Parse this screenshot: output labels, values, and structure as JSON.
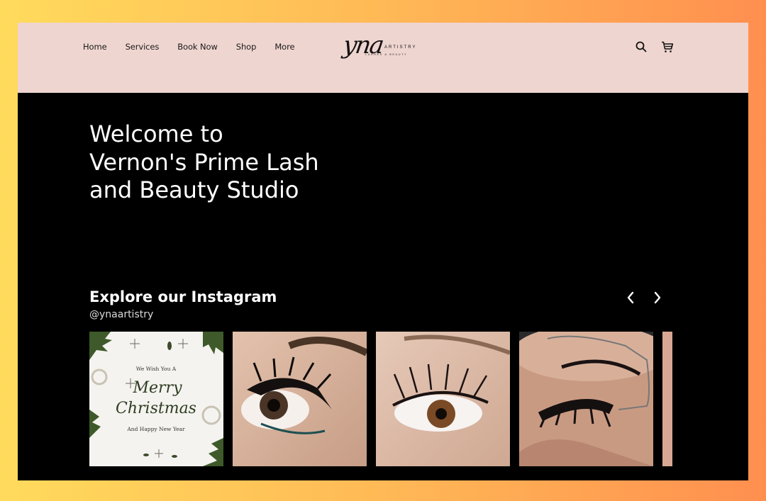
{
  "nav": {
    "items": [
      "Home",
      "Services",
      "Book Now",
      "Shop",
      "More"
    ]
  },
  "logo": {
    "script": "yna",
    "sub": "ARTISTRY",
    "tagline": "LASHES & BEAUTY"
  },
  "icons": {
    "search": "search-icon",
    "cart": "cart-icon"
  },
  "hero": {
    "title": "Welcome to Vernon's Prime Lash and Beauty Studio"
  },
  "instagram": {
    "title": "Explore our Instagram",
    "handle": "@ynaartistry",
    "posts": [
      {
        "type": "christmas-card",
        "line1": "We Wish You A",
        "line2": "Merry",
        "line3": "Christmas",
        "line4": "And Happy New Year"
      },
      {
        "type": "lash-photo"
      },
      {
        "type": "lash-photo"
      },
      {
        "type": "lash-photo"
      },
      {
        "type": "lash-photo-partial"
      }
    ]
  },
  "colors": {
    "header_bg": "#efd5d0",
    "body_bg": "#000000",
    "text_light": "#ffffff"
  }
}
